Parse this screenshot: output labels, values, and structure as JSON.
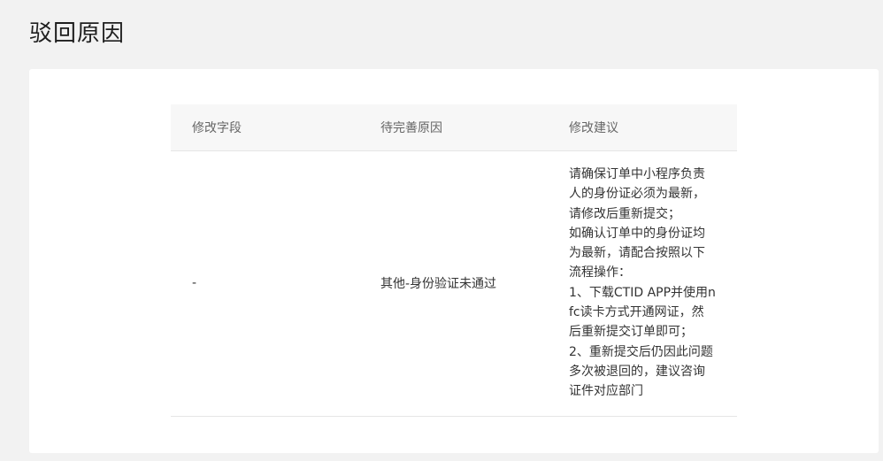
{
  "page": {
    "title": "驳回原因"
  },
  "table": {
    "headers": {
      "field": "修改字段",
      "reason": "待完善原因",
      "suggestion": "修改建议"
    },
    "rows": [
      {
        "field": "-",
        "reason": "其他-身份验证未通过",
        "suggestion_lines": [
          "请确保订单中小程序负责",
          "人的身份证必须为最新，",
          "请修改后重新提交；",
          "如确认订单中的身份证均",
          "为最新，请配合按照以下",
          "流程操作：",
          "1、下载CTID APP并使用n",
          "fc读卡方式开通网证，然",
          "后重新提交订单即可；",
          "2、重新提交后仍因此问题",
          "多次被退回的，建议咨询",
          "证件对应部门"
        ]
      }
    ]
  }
}
